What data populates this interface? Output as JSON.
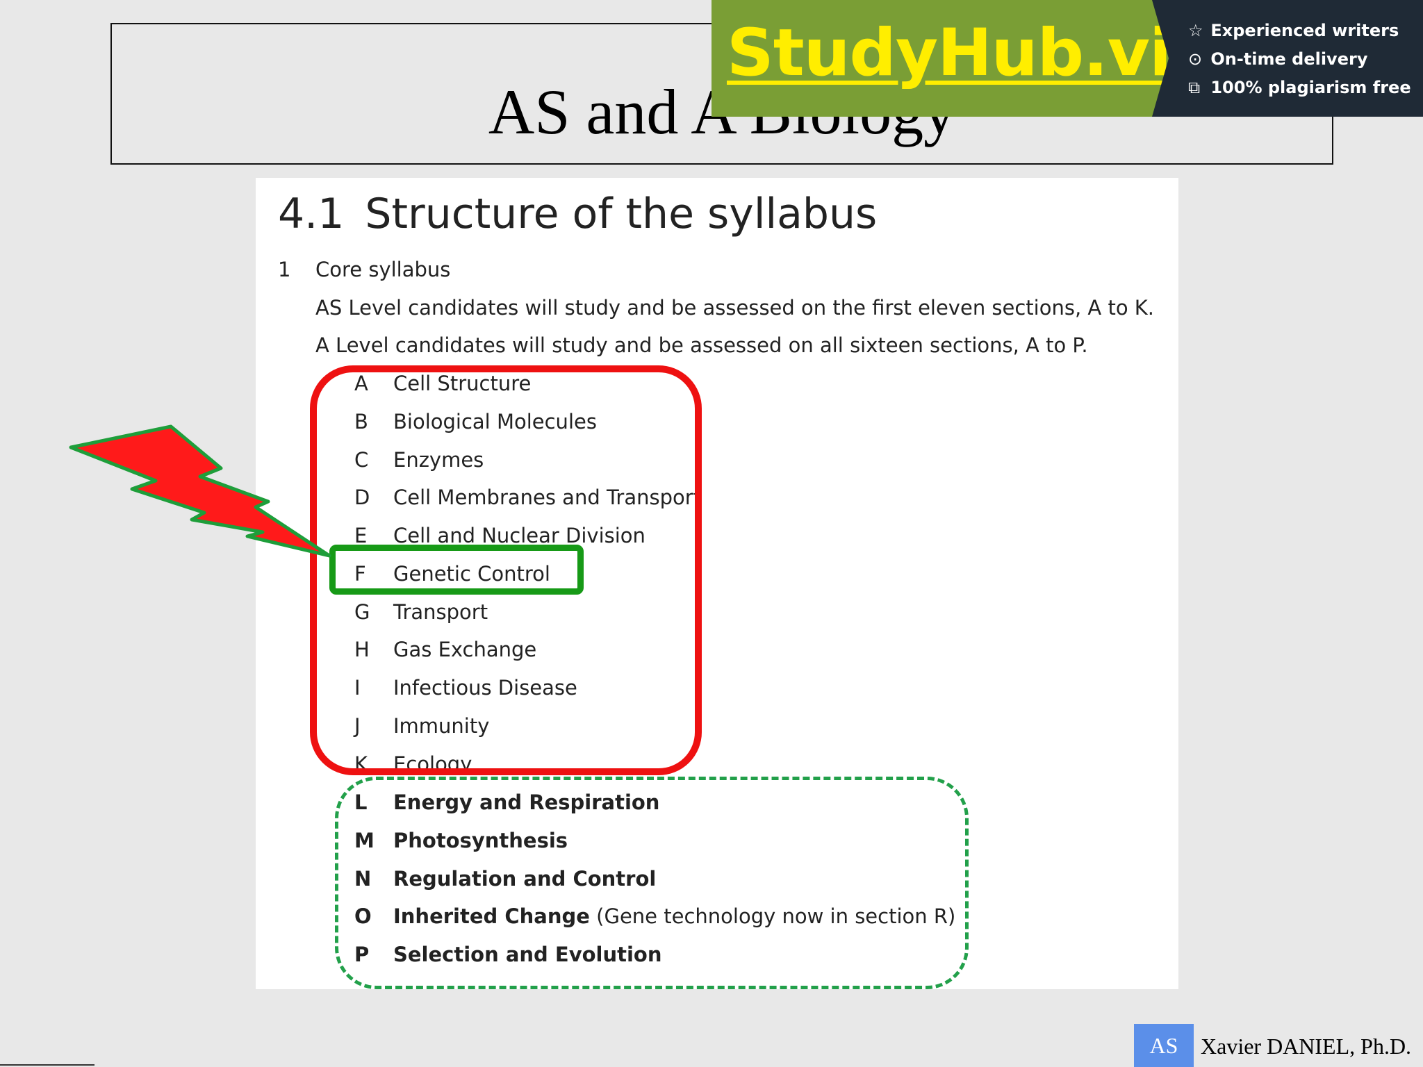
{
  "slide": {
    "title": "AS and A Biology"
  },
  "banner": {
    "brand": "StudyHub.vip",
    "features": [
      {
        "icon": "star-icon",
        "glyph": "☆",
        "label": "Experienced writers"
      },
      {
        "icon": "clock-icon",
        "glyph": "⊙",
        "label": "On-time delivery"
      },
      {
        "icon": "copy-icon",
        "glyph": "⧉",
        "label": "100% plagiarism free"
      }
    ]
  },
  "document": {
    "heading_number": "4.1",
    "heading_text": "Structure of the syllabus",
    "section_number": "1",
    "section_title": "Core syllabus",
    "as_level_note": "AS Level candidates will study and be assessed on the first eleven sections, A to K.",
    "a_level_note": "A Level candidates will study and be assessed on all sixteen sections, A to P.",
    "as_sections": [
      {
        "letter": "A",
        "label": "Cell Structure"
      },
      {
        "letter": "B",
        "label": "Biological Molecules"
      },
      {
        "letter": "C",
        "label": "Enzymes"
      },
      {
        "letter": "D",
        "label": "Cell Membranes and Transport"
      },
      {
        "letter": "E",
        "label": "Cell and Nuclear Division"
      },
      {
        "letter": "F",
        "label": "Genetic Control"
      },
      {
        "letter": "G",
        "label": "Transport"
      },
      {
        "letter": "H",
        "label": "Gas Exchange"
      },
      {
        "letter": "I",
        "label": "Infectious Disease"
      },
      {
        "letter": "J",
        "label": "Immunity"
      },
      {
        "letter": "K",
        "label": "Ecology"
      }
    ],
    "a_sections": [
      {
        "letter": "L",
        "label": "Energy and Respiration",
        "note": ""
      },
      {
        "letter": "M",
        "label": "Photosynthesis",
        "note": ""
      },
      {
        "letter": "N",
        "label": "Regulation and Control",
        "note": ""
      },
      {
        "letter": "O",
        "label": "Inherited Change",
        "note": " (Gene technology now in section R)"
      },
      {
        "letter": "P",
        "label": "Selection and Evolution",
        "note": ""
      }
    ]
  },
  "footer": {
    "badge": "AS",
    "author": "Xavier DANIEL, Ph.D."
  },
  "colors": {
    "red_highlight": "#ee1111",
    "green_highlight": "#179a17",
    "dashed_green": "#22a04a",
    "banner_green": "#7a9e35",
    "banner_dark": "#1f2a36",
    "brand_yellow": "#ffee00",
    "badge_blue": "#5b8fe9"
  }
}
